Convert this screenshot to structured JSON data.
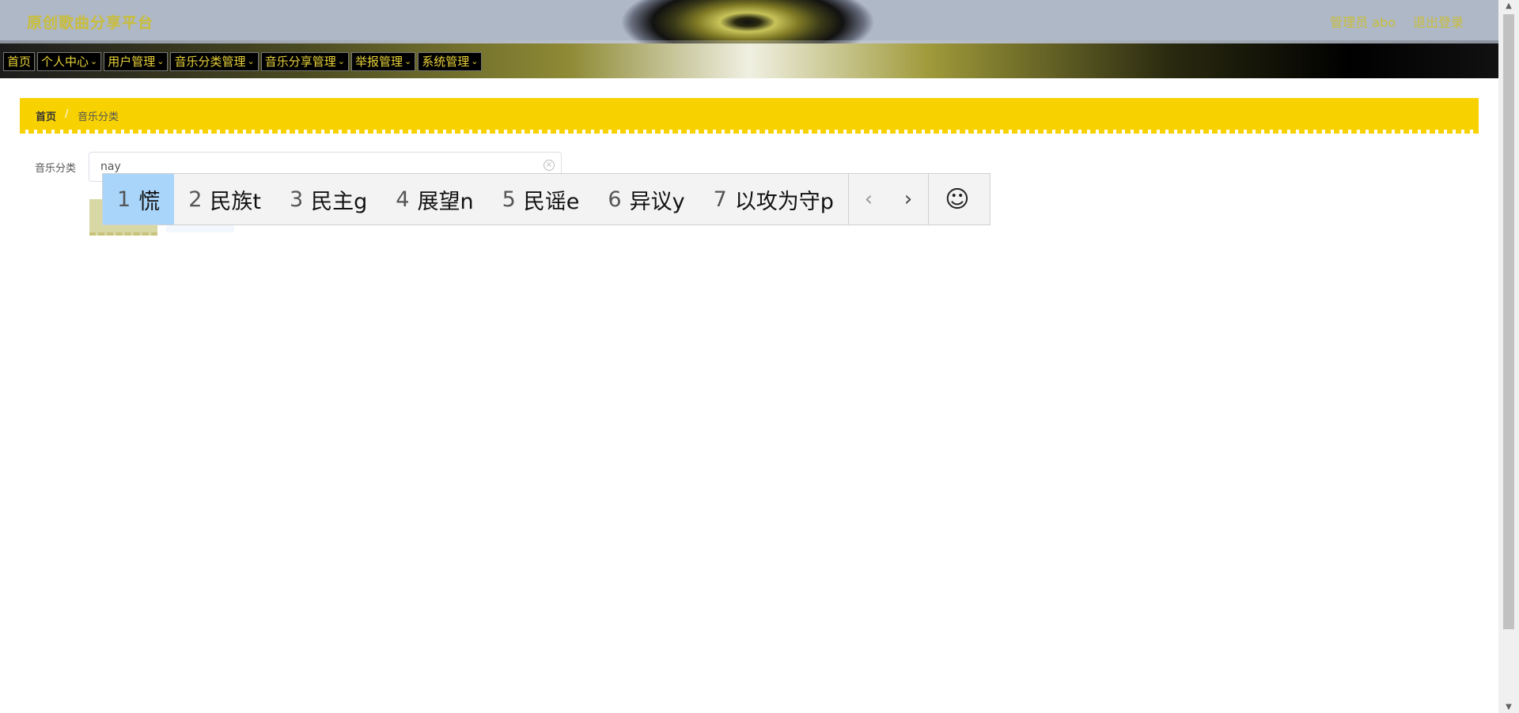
{
  "header": {
    "app_title": "原创歌曲分享平台",
    "admin": "管理员 abo",
    "logout": "退出登录"
  },
  "nav": {
    "items": [
      {
        "label": "首页",
        "has_dropdown": false
      },
      {
        "label": "个人中心",
        "has_dropdown": true
      },
      {
        "label": "用户管理",
        "has_dropdown": true
      },
      {
        "label": "音乐分类管理",
        "has_dropdown": true
      },
      {
        "label": "音乐分享管理",
        "has_dropdown": true
      },
      {
        "label": "举报管理",
        "has_dropdown": true
      },
      {
        "label": "系统管理",
        "has_dropdown": true
      }
    ],
    "dropdown_icon": "chevron-down-icon"
  },
  "breadcrumb": {
    "home": "首页",
    "separator": "/",
    "current": "音乐分类"
  },
  "search": {
    "label": "音乐分类",
    "value": "nay",
    "clear_icon": "circle-x-icon"
  },
  "ime": {
    "candidates": [
      {
        "num": "1",
        "text": "慌"
      },
      {
        "num": "2",
        "text": "民族t"
      },
      {
        "num": "3",
        "text": "民主g"
      },
      {
        "num": "4",
        "text": "展望n"
      },
      {
        "num": "5",
        "text": "民谣e"
      },
      {
        "num": "6",
        "text": "异议y"
      },
      {
        "num": "7",
        "text": "以攻为守p"
      }
    ],
    "prev_icon": "‹",
    "next_icon": "›",
    "emoji_icon": "☺"
  },
  "colors": {
    "accent": "#f8d200",
    "nav_text": "#e8d23a",
    "title_text": "#c9bd3a",
    "ime_selected": "#a9d5fb"
  }
}
